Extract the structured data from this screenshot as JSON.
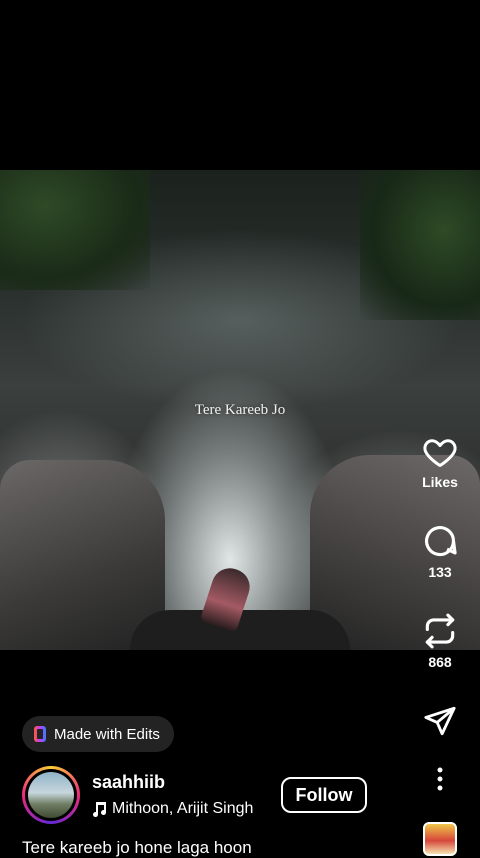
{
  "video": {
    "overlay_text": "Tere Kareeb Jo"
  },
  "actions": {
    "likes_label": "Likes",
    "comments_count": "133",
    "reposts_count": "868"
  },
  "edits_badge": {
    "label": "Made with Edits"
  },
  "author": {
    "username": "saahhiib",
    "music": "Mithoon, Arijit Singh",
    "follow_label": "Follow"
  },
  "caption": "Tere kareeb jo hone laga hoon"
}
